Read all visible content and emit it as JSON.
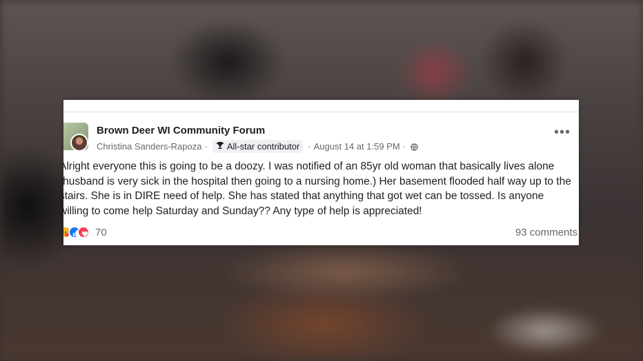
{
  "post": {
    "group_name": "Brown Deer WI Community Forum",
    "author": "Christina Sanders-Rapoza",
    "separator": "·",
    "badge": "All-star contributor",
    "timestamp": "August 14 at 1:59 PM",
    "privacy_icon": "globe-icon",
    "more_label": "•••",
    "body": "Alright everyone this is going to be a doozy. I was notified of an 85yr old woman that basically lives alone (husband is very sick in the hospital then going to a nursing home.) Her basement flooded half way up to the stairs. She is in DIRE need of help. She has stated that anything that got wet can be tossed. Is anyone willing to come help Saturday and Sunday?? Any type of help is appreciated!",
    "reaction_icons": [
      "care-reaction-icon",
      "like-reaction-icon",
      "love-reaction-icon"
    ],
    "reaction_count": "70",
    "comments": "93 comments"
  }
}
